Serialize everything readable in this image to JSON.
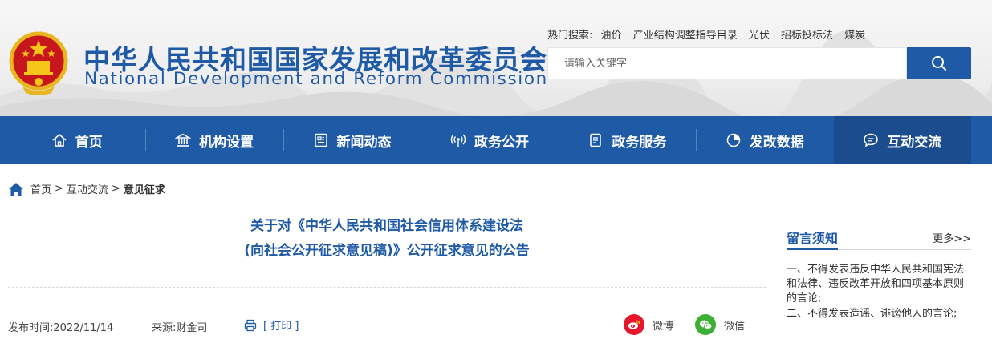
{
  "header": {
    "title_cn": "中华人民共和国国家发展和改革委员会",
    "title_en": "National Development and Reform Commission",
    "hot_search_label": "热门搜索:",
    "hot_keywords": [
      "油价",
      "产业结构调整指导目录",
      "光伏",
      "招标投标法",
      "煤炭"
    ],
    "search_placeholder": "请输入关键字"
  },
  "nav": {
    "items": [
      {
        "label": "首页",
        "icon": "home-icon"
      },
      {
        "label": "机构设置",
        "icon": "institution-icon"
      },
      {
        "label": "新闻动态",
        "icon": "news-icon"
      },
      {
        "label": "政务公开",
        "icon": "broadcast-icon"
      },
      {
        "label": "政务服务",
        "icon": "document-icon"
      },
      {
        "label": "发改数据",
        "icon": "pie-chart-icon"
      },
      {
        "label": "互动交流",
        "icon": "chat-icon",
        "active": true
      }
    ]
  },
  "breadcrumb": {
    "items": [
      "首页",
      "互动交流",
      "意见征求"
    ],
    "separator": ">"
  },
  "article": {
    "title_line1": "关于对《中华人民共和国社会信用体系建设法",
    "title_line2": "(向社会公开征求意见稿)》公开征求意见的公告",
    "date": "发布时间:2022/11/14",
    "source": "来源:财金司",
    "print_label": "[ 打印 ]",
    "share_weibo": "微博",
    "share_weixin": "微信"
  },
  "sidebar": {
    "title": "留言须知",
    "more": "更多>>",
    "rules": [
      "一、不得发表违反中华人民共和国宪法和法律、违反改革开放和四项基本原则的言论;",
      "二、不得发表造谣、诽谤他人的言论;"
    ]
  },
  "colors": {
    "brand_blue": "#1f5aa6",
    "nav_active": "#1a4c8e",
    "weibo_red": "#e6162d",
    "weixin_green": "#3cb034"
  }
}
